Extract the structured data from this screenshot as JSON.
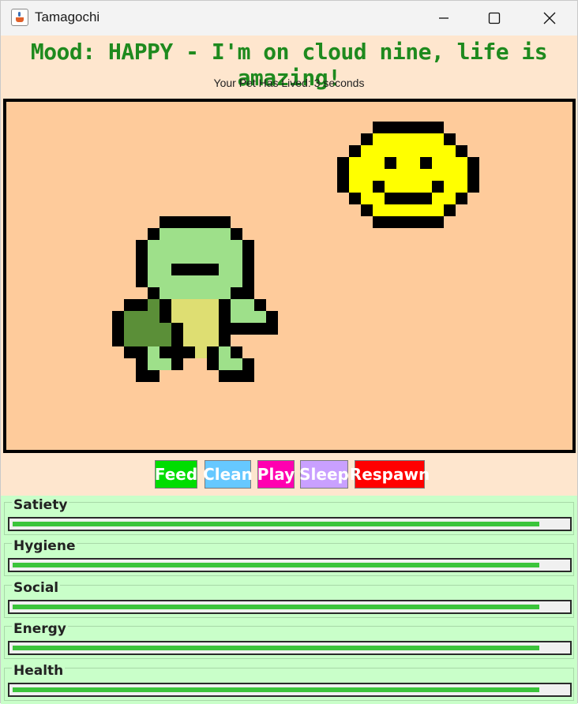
{
  "window": {
    "title": "Tamagochi",
    "icon": "java-cup-icon"
  },
  "header": {
    "mood": "Mood: HAPPY - I'm on cloud nine, life is amazing!",
    "mood_color": "#1e8a1e",
    "lived": "Your Pet Has Lived: 3 seconds"
  },
  "scene": {
    "background": "#fecb9b",
    "pet": "turtle-pet",
    "mood_face": "smiley-face"
  },
  "actions": [
    {
      "label": "Feed",
      "color": "#00dd00"
    },
    {
      "label": "Clean",
      "color": "#66c8ff"
    },
    {
      "label": "Play",
      "color": "#ff00b0"
    },
    {
      "label": "Sleep",
      "color": "#c9a0ff"
    },
    {
      "label": "Respawn",
      "color": "#ff0000"
    }
  ],
  "stats": [
    {
      "label": "Satiety",
      "value": 0.95
    },
    {
      "label": "Hygiene",
      "value": 0.95
    },
    {
      "label": "Social",
      "value": 0.95
    },
    {
      "label": "Energy",
      "value": 0.95
    },
    {
      "label": "Health",
      "value": 0.95
    }
  ]
}
